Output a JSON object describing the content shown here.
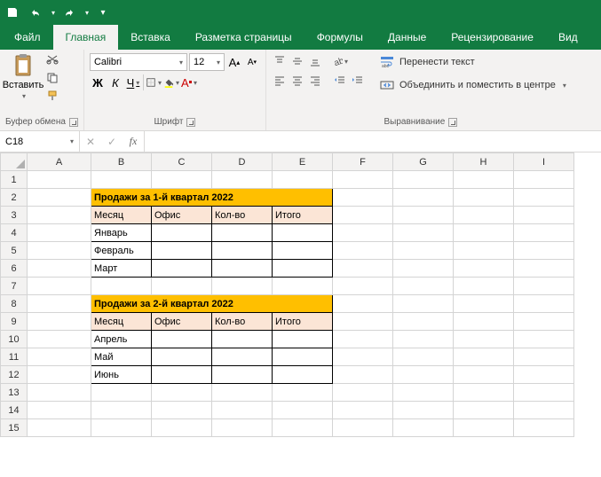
{
  "titlebar": {
    "save": "save",
    "undo": "undo",
    "redo": "redo"
  },
  "tabs": {
    "file": "Файл",
    "home": "Главная",
    "insert": "Вставка",
    "layout": "Разметка страницы",
    "formulas": "Формулы",
    "data": "Данные",
    "review": "Рецензирование",
    "view": "Вид"
  },
  "ribbon": {
    "clipboard": {
      "paste": "Вставить",
      "group": "Буфер обмена"
    },
    "font": {
      "name": "Calibri",
      "size": "12",
      "group": "Шрифт",
      "bold": "Ж",
      "italic": "К",
      "underline": "Ч"
    },
    "alignment": {
      "group": "Выравнивание"
    },
    "wrap": {
      "wrap": "Перенести текст",
      "merge": "Объединить и поместить в центре"
    }
  },
  "fbar": {
    "namebox": "C18"
  },
  "cols": [
    "A",
    "B",
    "C",
    "D",
    "E",
    "F",
    "G",
    "H",
    "I"
  ],
  "rows": [
    "1",
    "2",
    "3",
    "4",
    "5",
    "6",
    "7",
    "8",
    "9",
    "10",
    "11",
    "12",
    "13",
    "14",
    "15"
  ],
  "table1": {
    "title": "Продажи за 1-й квартал 2022",
    "h1": "Месяц",
    "h2": "Офис",
    "h3": "Кол-во",
    "h4": "Итого",
    "r1": "Январь",
    "r2": "Февраль",
    "r3": "Март"
  },
  "table2": {
    "title": "Продажи за 2-й квартал 2022",
    "h1": "Месяц",
    "h2": "Офис",
    "h3": "Кол-во",
    "h4": "Итого",
    "r1": "Апрель",
    "r2": "Май",
    "r3": "Июнь"
  }
}
